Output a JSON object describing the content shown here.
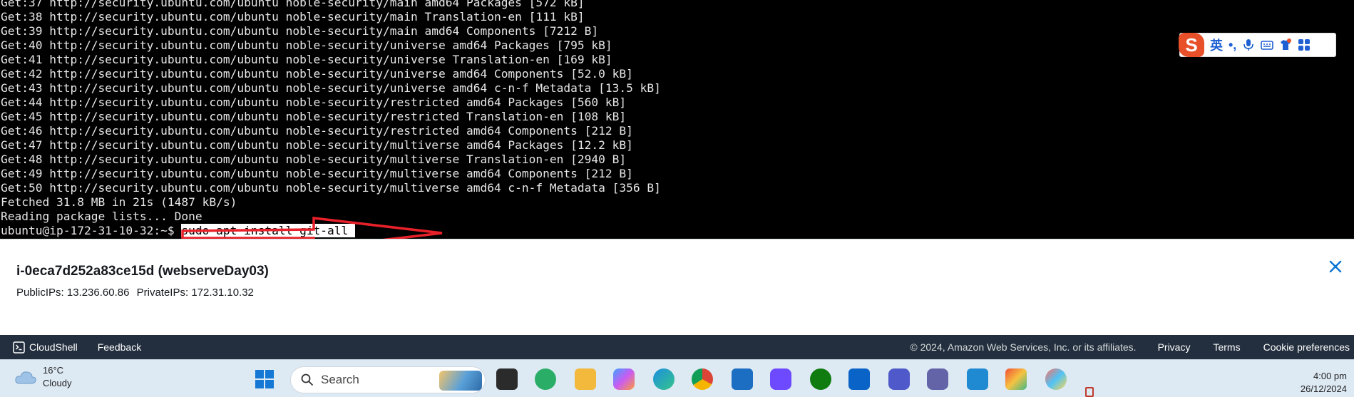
{
  "terminal": {
    "lines": [
      "Get:37 http://security.ubuntu.com/ubuntu noble-security/main amd64 Packages [572 kB]",
      "Get:38 http://security.ubuntu.com/ubuntu noble-security/main Translation-en [111 kB]",
      "Get:39 http://security.ubuntu.com/ubuntu noble-security/main amd64 Components [7212 B]",
      "Get:40 http://security.ubuntu.com/ubuntu noble-security/universe amd64 Packages [795 kB]",
      "Get:41 http://security.ubuntu.com/ubuntu noble-security/universe Translation-en [169 kB]",
      "Get:42 http://security.ubuntu.com/ubuntu noble-security/universe amd64 Components [52.0 kB]",
      "Get:43 http://security.ubuntu.com/ubuntu noble-security/universe amd64 c-n-f Metadata [13.5 kB]",
      "Get:44 http://security.ubuntu.com/ubuntu noble-security/restricted amd64 Packages [560 kB]",
      "Get:45 http://security.ubuntu.com/ubuntu noble-security/restricted Translation-en [108 kB]",
      "Get:46 http://security.ubuntu.com/ubuntu noble-security/restricted amd64 Components [212 B]",
      "Get:47 http://security.ubuntu.com/ubuntu noble-security/multiverse amd64 Packages [12.2 kB]",
      "Get:48 http://security.ubuntu.com/ubuntu noble-security/multiverse Translation-en [2940 B]",
      "Get:49 http://security.ubuntu.com/ubuntu noble-security/multiverse amd64 Components [212 B]",
      "Get:50 http://security.ubuntu.com/ubuntu noble-security/multiverse amd64 c-n-f Metadata [356 B]",
      "Fetched 31.8 MB in 21s (1487 kB/s)",
      "Reading package lists... Done"
    ],
    "prompt": "ubuntu@ip-172-31-10-32:~$ ",
    "command": "sudo apt install git-all "
  },
  "ime": {
    "logo": "S",
    "lang": "英",
    "punct": "•,",
    "accent_color": "#1e5fd4"
  },
  "instance": {
    "title": "i-0eca7d252a83ce15d (webserveDay03)",
    "public_ips": "PublicIPs: 13.236.60.86",
    "private_ips": "PrivateIPs: 172.31.10.32"
  },
  "footer": {
    "cloudshell": "CloudShell",
    "feedback": "Feedback",
    "copyright": "© 2024, Amazon Web Services, Inc. or its affiliates.",
    "privacy": "Privacy",
    "terms": "Terms",
    "cookies": "Cookie preferences",
    "bg_color": "#232f3e"
  },
  "taskbar": {
    "temperature": "16°C",
    "condition": "Cloudy",
    "search_label": "Search",
    "time": "4:00 pm",
    "date": "26/12/2024",
    "apps": [
      "file-explorer-icon",
      "wechat-icon",
      "folder-icon",
      "copilot-icon",
      "edge-icon",
      "chrome-icon",
      "store-icon",
      "proton-icon",
      "xbox-icon",
      "outlook-icon",
      "teams-icon",
      "teams-classic-icon",
      "vscode-icon",
      "git-icon",
      "paint-icon"
    ]
  }
}
